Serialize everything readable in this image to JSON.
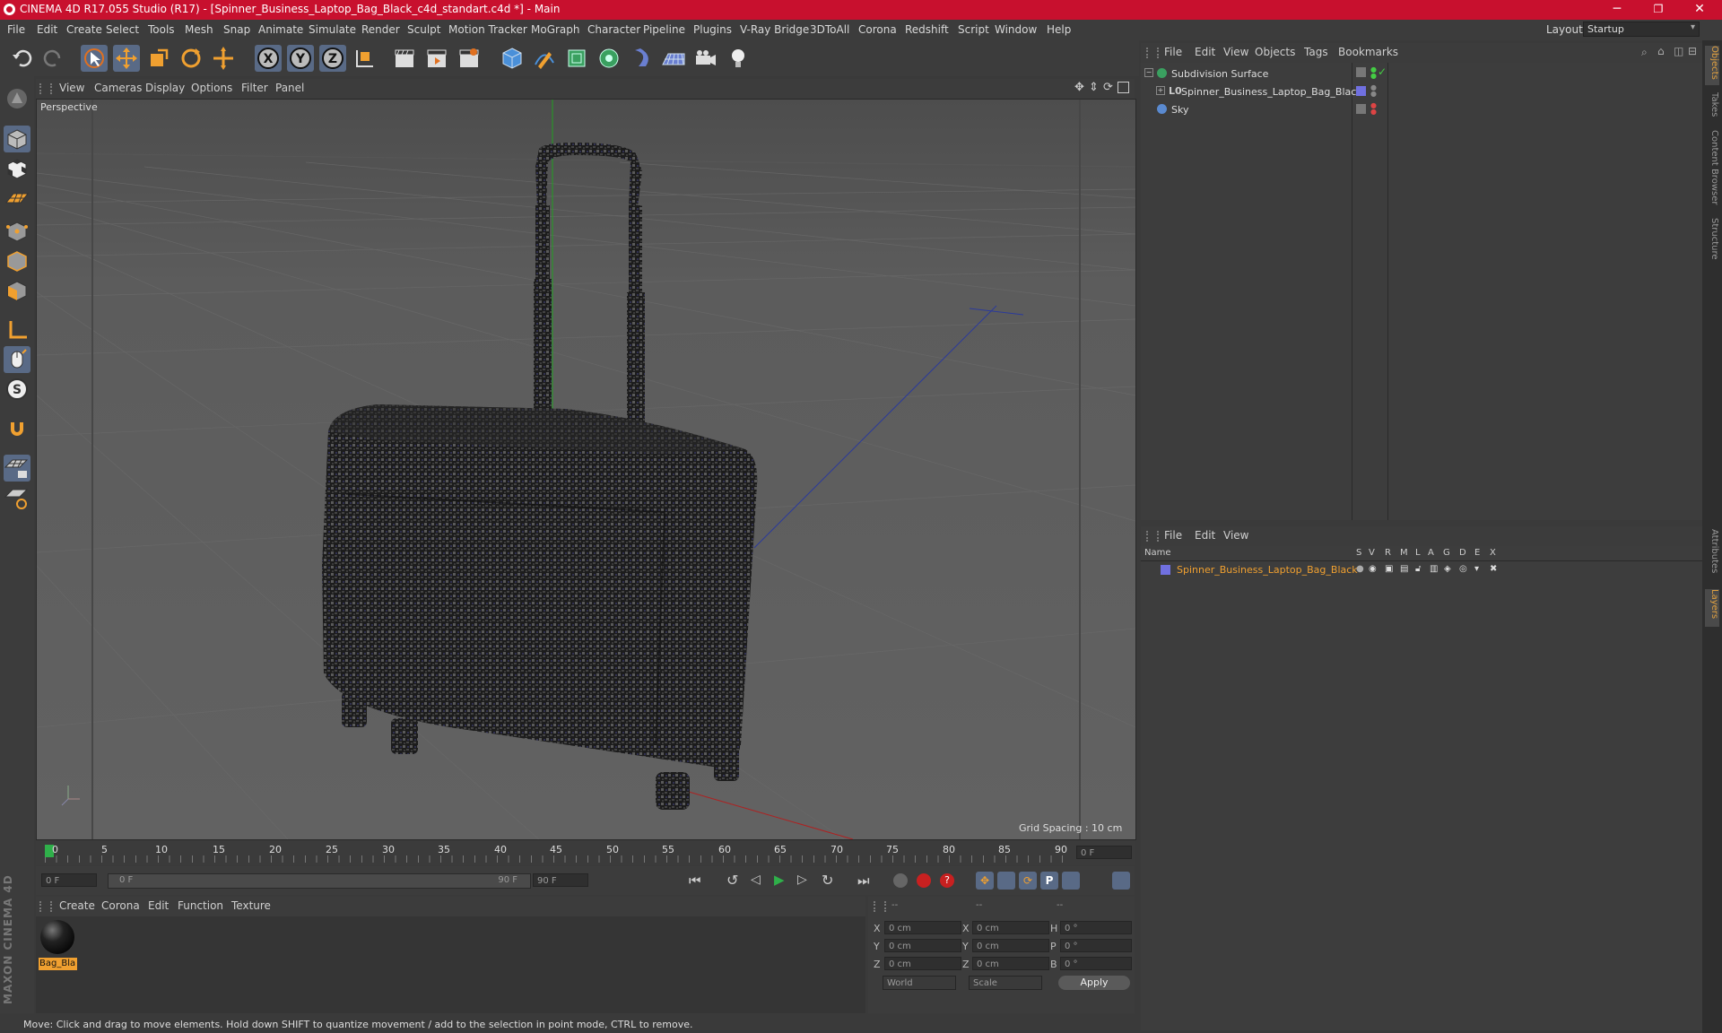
{
  "titlebar": {
    "title": "CINEMA 4D R17.055 Studio (R17) - [Spinner_Business_Laptop_Bag_Black_c4d_standart.c4d *] - Main",
    "minimize": "─",
    "maximize": "❐",
    "close": "✕"
  },
  "menubar": {
    "items": [
      "File",
      "Edit",
      "Create",
      "Select",
      "Tools",
      "Mesh",
      "Snap",
      "Animate",
      "Simulate",
      "Render",
      "Sculpt",
      "Motion Tracker",
      "MoGraph",
      "Character",
      "Pipeline",
      "Plugins",
      "V-Ray Bridge",
      "3DToAll",
      "Corona",
      "Redshift",
      "Script",
      "Window",
      "Help"
    ],
    "layout_label": "Layout:",
    "layout_value": "Startup"
  },
  "viewport": {
    "menu": [
      "View",
      "Cameras",
      "Display",
      "Options",
      "Filter",
      "Panel"
    ],
    "label": "Perspective",
    "grid_spacing": "Grid Spacing : 10 cm"
  },
  "timeline": {
    "ticks": [
      "0",
      "5",
      "10",
      "15",
      "20",
      "25",
      "30",
      "35",
      "40",
      "45",
      "50",
      "55",
      "60",
      "65",
      "70",
      "75",
      "80",
      "85",
      "90"
    ],
    "current_frame": "0 F",
    "start_field": "0 F",
    "slider_start": "0 F",
    "slider_end": "90 F",
    "end_field": "90 F"
  },
  "material_manager": {
    "menu": [
      "Create",
      "Corona",
      "Edit",
      "Function",
      "Texture"
    ],
    "materials": [
      {
        "name": "Bag_Bla"
      }
    ]
  },
  "coordinates": {
    "header": [
      "--",
      "--",
      "--"
    ],
    "rows": [
      {
        "axis": "X",
        "pos": "0 cm",
        "axis2": "X",
        "size": "0 cm",
        "axis3": "H",
        "rot": "0 °"
      },
      {
        "axis": "Y",
        "pos": "0 cm",
        "axis2": "Y",
        "size": "0 cm",
        "axis3": "P",
        "rot": "0 °"
      },
      {
        "axis": "Z",
        "pos": "0 cm",
        "axis2": "Z",
        "size": "0 cm",
        "axis3": "B",
        "rot": "0 °"
      }
    ],
    "mode1": "World",
    "mode2": "Scale",
    "apply": "Apply"
  },
  "status": {
    "text": "Move: Click and drag to move elements. Hold down SHIFT to quantize movement / add to the selection in point mode, CTRL to remove."
  },
  "object_manager": {
    "menu": [
      "File",
      "Edit",
      "View",
      "Objects",
      "Tags",
      "Bookmarks"
    ],
    "objects": [
      {
        "name": "Subdivision Surface"
      },
      {
        "name": "Spinner_Business_Laptop_Bag_Black"
      },
      {
        "name": "Sky"
      }
    ]
  },
  "layer_manager": {
    "menu": [
      "File",
      "Edit",
      "View"
    ],
    "columns": [
      "Name",
      "S",
      "V",
      "R",
      "M",
      "L",
      "A",
      "G",
      "D",
      "E",
      "X"
    ],
    "layers": [
      {
        "name": "Spinner_Business_Laptop_Bag_Black"
      }
    ]
  },
  "right_tabs": [
    "Objects",
    "Takes",
    "Content Browser",
    "Structure",
    "Attributes",
    "Layers"
  ],
  "brand": "MAXON CINEMA 4D",
  "colors": {
    "titlebar": "#c8102e",
    "accent_orange": "#f0a030",
    "highlight_blue": "#596a86"
  }
}
